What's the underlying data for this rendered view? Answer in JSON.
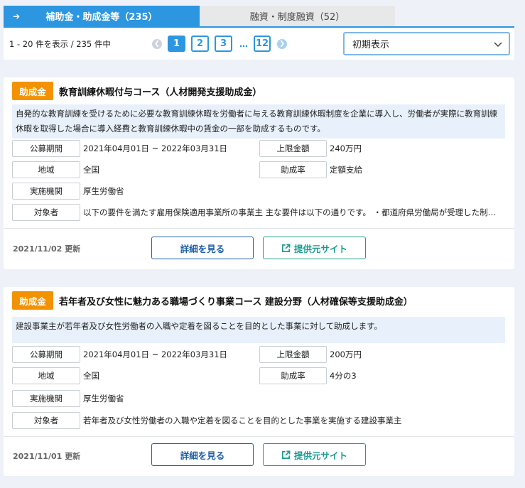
{
  "tabs": [
    {
      "label": "補助金・助成金等（235）",
      "active": true
    },
    {
      "label": "融資・制度融資（52）",
      "active": false
    }
  ],
  "toolbar": {
    "range_text": "1 - 20 件を表示 / 235 件中",
    "pages": [
      "1",
      "2",
      "3",
      "12"
    ],
    "dots": "…",
    "sort_value": "初期表示"
  },
  "labels": {
    "period": "公募期間",
    "max_amount": "上限金額",
    "region": "地域",
    "rate": "助成率",
    "agency": "実施機関",
    "target": "対象者",
    "detail_button": "詳細を見る",
    "site_button": "提供元サイト"
  },
  "cards": [
    {
      "badge": "助成金",
      "title": "教育訓練休暇付与コース（人材開発支援助成金）",
      "description": "自発的な教育訓練を受けるために必要な教育訓練休暇を労働者に与える教育訓練休暇制度を企業に導入し、労働者が実際に教育訓練休暇を取得した場合に導入経費と教育訓練休暇中の賃金の一部を助成するものです。",
      "period": "2021年04月01日 ~ 2022年03月31日",
      "max_amount": "240万円",
      "region": "全国",
      "rate": "定額支給",
      "agency": "厚生労働省",
      "target": "以下の要件を満たす雇用保険適用事業所の事業主 主な要件は以下の通りです。 ・都道府県労働局が受理した制度導入・適用計画に基づき、教育訓練休暇制度を導入",
      "updated": "2021/11/02 更新"
    },
    {
      "badge": "助成金",
      "title": "若年者及び女性に魅力ある職場づくり事業コース 建設分野（人材確保等支援助成金）",
      "description": "建設事業主が若年者及び女性労働者の入職や定着を図ることを目的とした事業に対して助成します。",
      "period": "2021年04月01日 ~ 2022年03月31日",
      "max_amount": "200万円",
      "region": "全国",
      "rate": "4分の3",
      "agency": "厚生労働省",
      "target": "若年者及び女性労働者の入職や定着を図ることを目的とした事業を実施する建設事業主",
      "updated": "2021/11/01 更新"
    }
  ],
  "colors": {
    "accent": "#2d96e0",
    "badge": "#f39200",
    "detail": "#1f5fa8",
    "site": "#1c9a8e"
  }
}
